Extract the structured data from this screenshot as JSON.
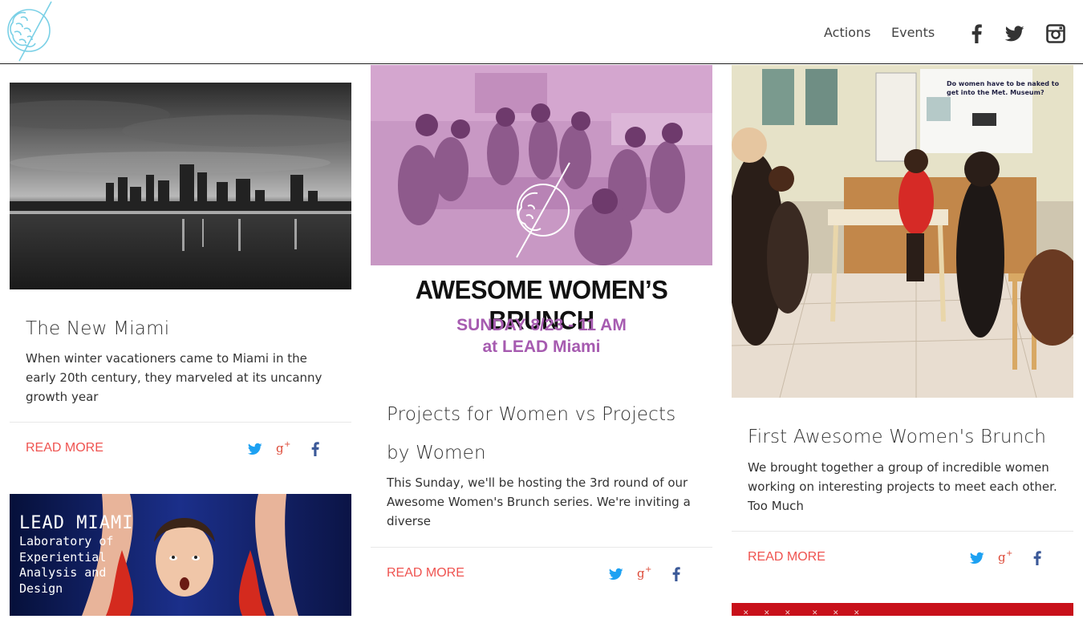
{
  "nav": {
    "actions": "Actions",
    "events": "Events"
  },
  "icons": {
    "logo": "brain-logo-icon",
    "facebook": "facebook-icon",
    "twitter": "twitter-icon",
    "instagram": "instagram-icon",
    "googleplus": "google-plus-icon"
  },
  "colors": {
    "accent": "#ef5350",
    "logo": "#7ad0e6",
    "twitter": "#1da1f2",
    "gplus": "#dd4b39",
    "facebook": "#3b5998",
    "brunch_purple": "#a65bb0"
  },
  "cards": [
    {
      "title": "The New Miami",
      "text": "When winter vacationers came to Miami in the early 20th century, they marveled at its uncanny growth year",
      "read_more": "READ MORE"
    },
    {
      "title": "Projects for Women vs Projects by Women",
      "text": "This Sunday, we'll be hosting the 3rd round of our Awesome Women's Brunch series. We're inviting a diverse",
      "read_more": "READ MORE",
      "poster": {
        "headline": "AWESOME WOMEN’S BRUNCH",
        "date": "SUNDAY 8/23 - 11 AM",
        "place": "at LEAD Miami"
      }
    },
    {
      "title": "First Awesome Women's Brunch",
      "text": "We brought together a group of incredible women working on interesting projects to meet each other. Too Much",
      "read_more": "READ MORE",
      "slide": {
        "heading": "Do women have to be naked to get into the Met. Museum?"
      }
    },
    {
      "poster": {
        "title": "LEAD MIAMI",
        "subtitle": "Laboratory of Experiential Analysis and Design"
      }
    }
  ]
}
